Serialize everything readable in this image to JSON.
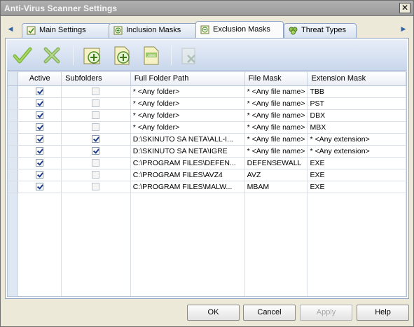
{
  "window": {
    "title": "Anti-Virus Scanner Settings",
    "close_glyph": "✕"
  },
  "tabs": [
    {
      "label": "Main Settings",
      "icon": "settings-icon"
    },
    {
      "label": "Inclusion Masks",
      "icon": "include-icon"
    },
    {
      "label": "Exclusion Masks",
      "icon": "exclude-icon",
      "active": true
    },
    {
      "label": "Threat Types",
      "icon": "threat-icon"
    }
  ],
  "tab_nav": {
    "left": "◀",
    "right": "▶"
  },
  "toolbar": {
    "buttons": [
      "apply-check",
      "cancel-x",
      "add-folder",
      "add-file",
      "add-exe",
      "remove"
    ]
  },
  "grid": {
    "columns": [
      "Active",
      "Subfolders",
      "Full Folder Path",
      "File Mask",
      "Extension Mask"
    ],
    "rows": [
      {
        "active": true,
        "subfolders": false,
        "path": "* <Any folder>",
        "file_mask": "* <Any file name>",
        "ext_mask": "TBB"
      },
      {
        "active": true,
        "subfolders": false,
        "path": "* <Any folder>",
        "file_mask": "* <Any file name>",
        "ext_mask": "PST"
      },
      {
        "active": true,
        "subfolders": false,
        "path": "* <Any folder>",
        "file_mask": "* <Any file name>",
        "ext_mask": "DBX"
      },
      {
        "active": true,
        "subfolders": false,
        "path": "* <Any folder>",
        "file_mask": "* <Any file name>",
        "ext_mask": "MBX"
      },
      {
        "active": true,
        "subfolders": true,
        "path": "D:\\SKINUTO SA NETA\\ALL-I...",
        "file_mask": "* <Any file name>",
        "ext_mask": "* <Any extension>"
      },
      {
        "active": true,
        "subfolders": true,
        "path": "D:\\SKINUTO SA NETA\\IGRE",
        "file_mask": "* <Any file name>",
        "ext_mask": "* <Any extension>"
      },
      {
        "active": true,
        "subfolders": false,
        "path": "C:\\PROGRAM FILES\\DEFEN...",
        "file_mask": "DEFENSEWALL",
        "ext_mask": "EXE"
      },
      {
        "active": true,
        "subfolders": false,
        "path": "C:\\PROGRAM FILES\\AVZ4",
        "file_mask": "AVZ",
        "ext_mask": "EXE"
      },
      {
        "active": true,
        "subfolders": false,
        "path": "C:\\PROGRAM FILES\\MALW...",
        "file_mask": "MBAM",
        "ext_mask": "EXE"
      }
    ]
  },
  "buttons": {
    "ok": "OK",
    "cancel": "Cancel",
    "apply": "Apply",
    "help": "Help"
  }
}
